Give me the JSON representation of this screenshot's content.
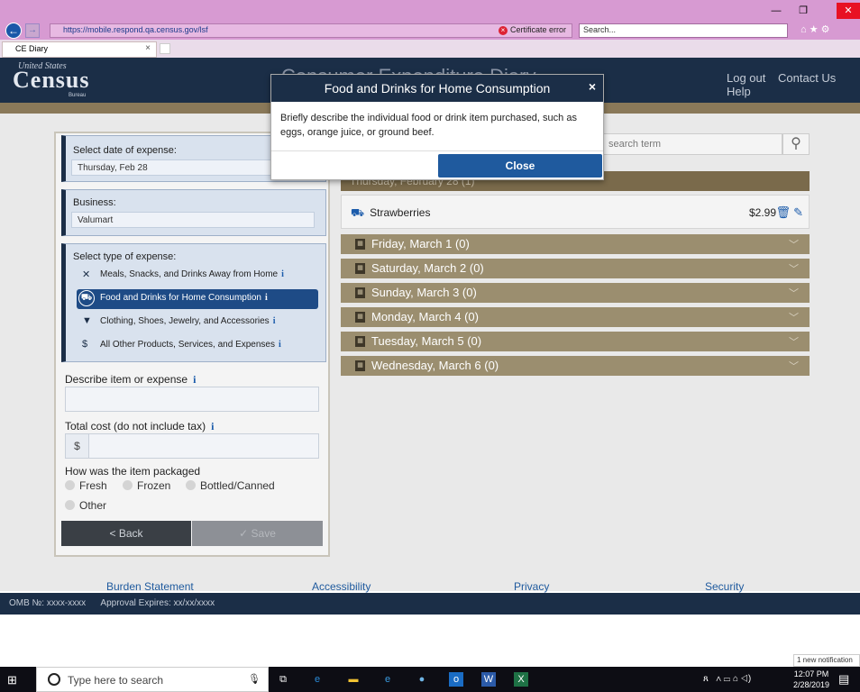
{
  "browser": {
    "url": "https://mobile.respond.qa.census.gov/lsf",
    "certificate_error": "Certificate error",
    "search_placeholder": "Search...",
    "tab_title": "CE Diary",
    "tab_close": "×"
  },
  "header": {
    "logo_top": "United States",
    "logo_main": "Census",
    "logo_bureau": "Bureau",
    "title": "Consumer Expenditure Diary",
    "links": [
      "Log out",
      "Contact Us",
      "Help"
    ]
  },
  "form": {
    "date_label": "Select date of expense:",
    "date_value": "Thursday, Feb 28",
    "business_label": "Business:",
    "business_value": "Valumart",
    "type_label": "Select type of expense:",
    "types": [
      {
        "label": "Meals, Snacks, and Drinks Away from Home",
        "icon": "utensils-icon",
        "selected": false
      },
      {
        "label": "Food and Drinks for Home Consumption",
        "icon": "cart-icon",
        "selected": true
      },
      {
        "label": "Clothing, Shoes, Jewelry, and Accessories",
        "icon": "shirt-icon",
        "selected": false
      },
      {
        "label": "All Other Products, Services, and Expenses",
        "icon": "dollar-icon",
        "selected": false
      }
    ],
    "info_glyph": "i",
    "describe_label": "Describe item or expense",
    "cost_label": "Total cost (do not include tax)",
    "cost_prefix": "$",
    "package_label": "How was the item packaged",
    "package_options": [
      "Fresh",
      "Frozen",
      "Bottled/Canned",
      "Other"
    ],
    "back_label": "< Back",
    "save_label": "✓ Save"
  },
  "right": {
    "search_placeholder": "search term",
    "thursday_label": "Thursday, February 28 (1)",
    "item": {
      "name": "Strawberries",
      "price": "$2.99"
    },
    "days": [
      "Friday, March 1 (0)",
      "Saturday, March 2 (0)",
      "Sunday, March 3 (0)",
      "Monday, March 4 (0)",
      "Tuesday, March 5 (0)",
      "Wednesday, March 6 (0)"
    ]
  },
  "modal": {
    "title": "Food and Drinks for Home Consumption",
    "body": "Briefly describe the individual food or drink item purchased, such as eggs, orange juice, or ground beef.",
    "close_label": "Close",
    "close_x": "×"
  },
  "footer": {
    "links": [
      "Burden Statement",
      "Accessibility",
      "Privacy",
      "Security"
    ],
    "omb": "OMB №: xxxx-xxxx",
    "approval": "Approval Expires: xx/xx/xxxx"
  },
  "taskbar": {
    "search_placeholder": "Type here to search",
    "time": "12:07 PM",
    "date": "2/28/2019",
    "notification": "1 new notification"
  }
}
